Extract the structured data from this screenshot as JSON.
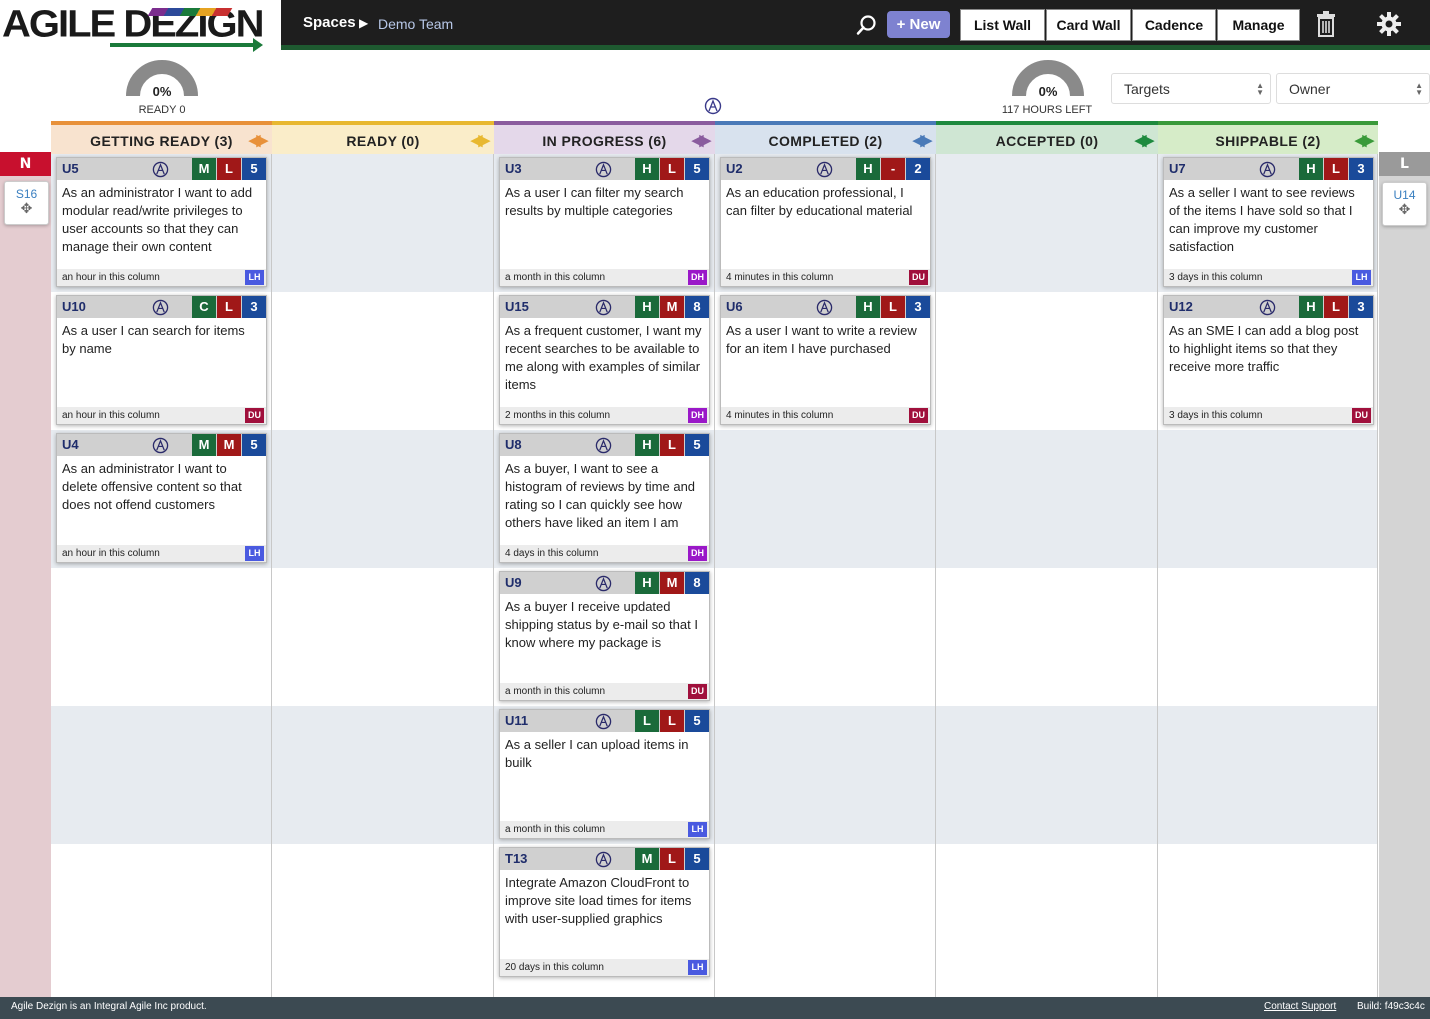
{
  "brand": {
    "logo_text": "AGILE DEZIGN"
  },
  "breadcrumb": {
    "root": "Spaces",
    "separator": "▶",
    "current": "Demo Team"
  },
  "toolbar": {
    "new_label": "+ New",
    "buttons": [
      "List Wall",
      "Card Wall",
      "Cadence",
      "Manage"
    ],
    "icons": [
      "search-icon",
      "trash-icon",
      "gear-icon"
    ]
  },
  "gauges": {
    "ready": {
      "value_percent": 0,
      "label": "0%",
      "caption": "READY 0"
    },
    "hours": {
      "value_percent": 0,
      "label": "0%",
      "caption": "117 HOURS LEFT"
    }
  },
  "filters": {
    "targets": "Targets",
    "owner": "Owner"
  },
  "columns": [
    {
      "label": "GETTING READY",
      "count": "(3)",
      "color": "#e8913a",
      "bg": "#f8e3cf"
    },
    {
      "label": "READY",
      "count": "(0)",
      "color": "#e8b830",
      "bg": "#faedc9"
    },
    {
      "label": "IN PROGRESS",
      "count": "(6)",
      "color": "#8a5c9e",
      "bg": "#e4d8ea"
    },
    {
      "label": "COMPLETED",
      "count": "(2)",
      "color": "#4a7ab8",
      "bg": "#d8e2ee"
    },
    {
      "label": "ACCEPTED",
      "count": "(0)",
      "color": "#1e8a3e",
      "bg": "#cfe6d3"
    },
    {
      "label": "SHIPPABLE",
      "count": "(2)",
      "color": "#3a9a3a",
      "bg": "#d6ecc8"
    }
  ],
  "left_lane": {
    "label": "N",
    "color": "#c8102e",
    "card": "S16"
  },
  "right_lane": {
    "label": "L",
    "color": "#9a9a9a",
    "card": "U14"
  },
  "badge_colors": {
    "H": "#1a6a3a",
    "C": "#1a6a3a",
    "L": "#a01818",
    "M": "#1a6a3a",
    "M2": "#a01818",
    "dash": "#a01818",
    "size": "#1a4a9a"
  },
  "owner_colors": {
    "LH": "#4a5ae0",
    "DU": "#a0103c",
    "DH": "#9a18c8"
  },
  "cards": [
    {
      "id": "U5",
      "text": "As an administrator I want to add modular read/write privileges to user accounts so that they can manage their own content",
      "badges": [
        "M",
        "L",
        "5"
      ],
      "time": "an hour in this column",
      "owner": "LH"
    },
    {
      "id": "U10",
      "text": "As a user I can search for items by name",
      "badges": [
        "C",
        "L",
        "3"
      ],
      "time": "an hour in this column",
      "owner": "DU"
    },
    {
      "id": "U4",
      "text": "As an administrator I want to delete offensive content so that does not offend customers",
      "badges": [
        "M",
        "M",
        "5"
      ],
      "time": "an hour in this column",
      "owner": "LH"
    },
    {
      "id": "U3",
      "text": "As a user I can filter my search results by multiple categories",
      "badges": [
        "H",
        "L",
        "5"
      ],
      "time": "a month in this column",
      "owner": "DH"
    },
    {
      "id": "U15",
      "text": "As a frequent customer, I want my recent searches to be available to me along with examples of similar items",
      "badges": [
        "H",
        "M",
        "8"
      ],
      "time": "2 months in this column",
      "owner": "DH"
    },
    {
      "id": "U8",
      "text": "As a buyer, I want to see a histogram of reviews by time and rating so I can quickly see how others have liked an item I am",
      "badges": [
        "H",
        "L",
        "5"
      ],
      "time": "4 days in this column",
      "owner": "DH"
    },
    {
      "id": "U9",
      "text": "As a buyer I receive updated shipping status by e-mail so that I know where my package is",
      "badges": [
        "H",
        "M",
        "8"
      ],
      "time": "a month in this column",
      "owner": "DU"
    },
    {
      "id": "U11",
      "text": "As a seller I can upload items in builk",
      "badges": [
        "L",
        "L",
        "5"
      ],
      "time": "a month in this column",
      "owner": "LH"
    },
    {
      "id": "T13",
      "text": "Integrate Amazon CloudFront to improve site load times for items with user-supplied graphics",
      "badges": [
        "M",
        "L",
        "5"
      ],
      "time": "20 days in this column",
      "owner": "LH"
    },
    {
      "id": "U2",
      "text": "As an education professional, I can filter by educational material",
      "badges": [
        "H",
        "-",
        "2"
      ],
      "time": "4 minutes in this column",
      "owner": "DU"
    },
    {
      "id": "U6",
      "text": "As a user I want to write a review for an item I have purchased",
      "badges": [
        "H",
        "L",
        "3"
      ],
      "time": "4 minutes in this column",
      "owner": "DU"
    },
    {
      "id": "U7",
      "text": "As a seller I want to see reviews of the items I have sold so that I can improve my customer satisfaction",
      "badges": [
        "H",
        "L",
        "3"
      ],
      "time": "3 days in this column",
      "owner": "LH"
    },
    {
      "id": "U12",
      "text": "As an SME I can add a blog post to highlight items so that they receive more traffic",
      "badges": [
        "H",
        "L",
        "3"
      ],
      "time": "3 days in this column",
      "owner": "DU"
    }
  ],
  "footer": {
    "left": "Agile Dezign is an Integral Agile Inc product.",
    "contact": "Contact Support",
    "build": "Build: f49c3c4c"
  }
}
